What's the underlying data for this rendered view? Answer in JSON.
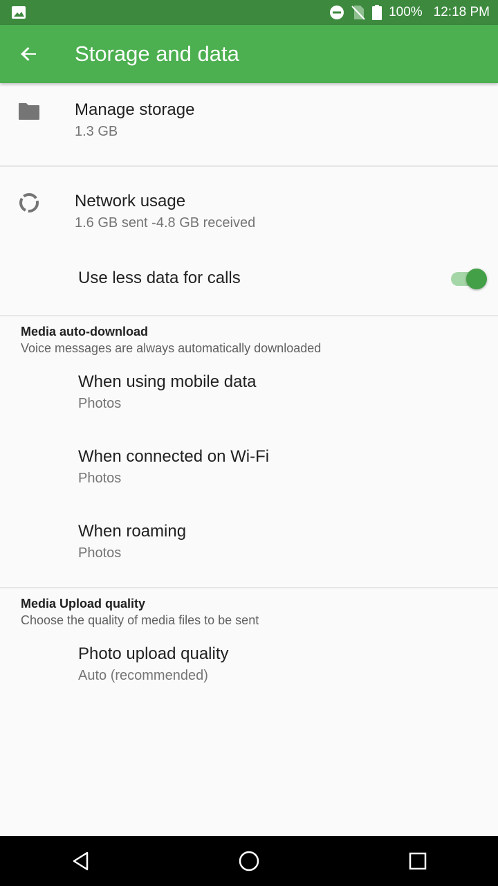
{
  "status_bar": {
    "battery_text": "100%",
    "time": "12:18 PM",
    "icons": [
      "image-icon",
      "do-not-disturb-icon",
      "no-sim-icon",
      "battery-icon"
    ]
  },
  "app_bar": {
    "title": "Storage and data",
    "back_icon": "arrow-back-icon",
    "color": "#4caf50"
  },
  "storage": {
    "primary": "Manage storage",
    "secondary": "1.3 GB",
    "icon": "folder-icon"
  },
  "network": {
    "primary": "Network usage",
    "secondary": "1.6 GB sent -4.8 GB received",
    "icon": "data-usage-icon"
  },
  "less_data": {
    "label": "Use less data for calls",
    "enabled": true
  },
  "auto_download": {
    "header": "Media auto-download",
    "subheader": "Voice messages are always automatically downloaded",
    "items": [
      {
        "primary": "When using mobile data",
        "secondary": "Photos"
      },
      {
        "primary": "When connected on Wi-Fi",
        "secondary": "Photos"
      },
      {
        "primary": "When roaming",
        "secondary": "Photos"
      }
    ]
  },
  "upload_quality": {
    "header": "Media Upload quality",
    "subheader": "Choose the quality of media files to be sent",
    "item": {
      "primary": "Photo upload quality",
      "secondary": "Auto (recommended)"
    }
  },
  "nav_bar": {
    "icons": [
      "back-triangle-icon",
      "home-circle-icon",
      "recents-square-icon"
    ]
  }
}
